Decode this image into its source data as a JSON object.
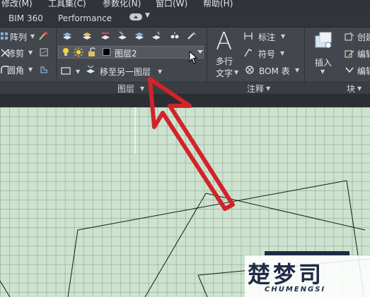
{
  "menu": {
    "items": [
      "修改(M)",
      "工具集(C)",
      "参数化(N)",
      "窗口(W)",
      "帮助(H)"
    ]
  },
  "tabs": {
    "items": [
      "BIM 360",
      "Performance"
    ]
  },
  "modify_panel": {
    "array_label": "阵列",
    "trim_label": "修剪",
    "fillet_label": "圆角"
  },
  "layers_panel": {
    "current_layer": "图层2",
    "move_to_layer_label": "移至另一图层",
    "panel_title": "图层"
  },
  "annotation_panel": {
    "multiline_text_line1": "多行",
    "multiline_text_line2": "文字",
    "dimension_label": "标注",
    "symbol_label": "符号",
    "bom_label": "BOM 表",
    "panel_title": "注释"
  },
  "block_panel": {
    "insert_label": "插入",
    "create_label": "创建",
    "edit_label": "编辑",
    "edit_attr_label": "编辑",
    "panel_title": "块"
  },
  "watermark": {
    "logo_text": "楚梦司",
    "brand_text": "CHUMENGSI"
  },
  "colors": {
    "ribbon_bg": "#43474d",
    "canvas_bg": "#cde3cf",
    "annotation_arrow": "#d2232a"
  }
}
